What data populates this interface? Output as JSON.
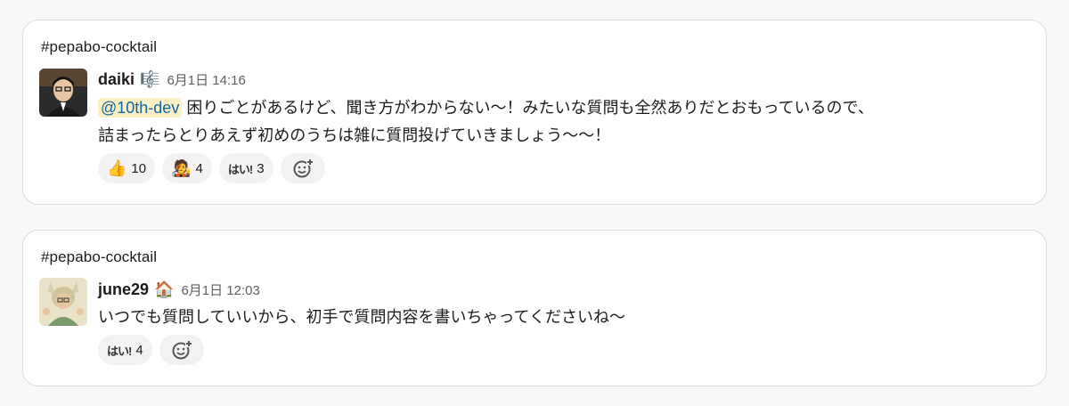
{
  "messages": [
    {
      "channel": "#pepabo-cocktail",
      "username": "daiki",
      "status_emoji": "🎼",
      "timestamp": "6月1日 14:16",
      "mention": "@10th-dev",
      "text_line1": "困りごとがあるけど、聞き方がわからない〜！みたいな質問も全然ありだとおもっているので、",
      "text_line2": "詰まったらとりあえず初めのうちは雑に質問投げていきましょう〜〜！",
      "reactions": [
        {
          "emoji": "👍",
          "count": "10"
        },
        {
          "emoji": "🧑‍🎤",
          "count": "4"
        },
        {
          "emoji": "はい!",
          "count": "3"
        }
      ]
    },
    {
      "channel": "#pepabo-cocktail",
      "username": "june29",
      "status_emoji": "🏠",
      "timestamp": "6月1日 12:03",
      "text": "いつでも質問していいから、初手で質問内容を書いちゃってくださいね〜",
      "reactions": [
        {
          "emoji": "はい!",
          "count": "4"
        }
      ]
    }
  ],
  "colors": {
    "mention_bg": "#fbefc4",
    "mention_text": "#1264a3",
    "reaction_bg": "#f2f2f2"
  }
}
